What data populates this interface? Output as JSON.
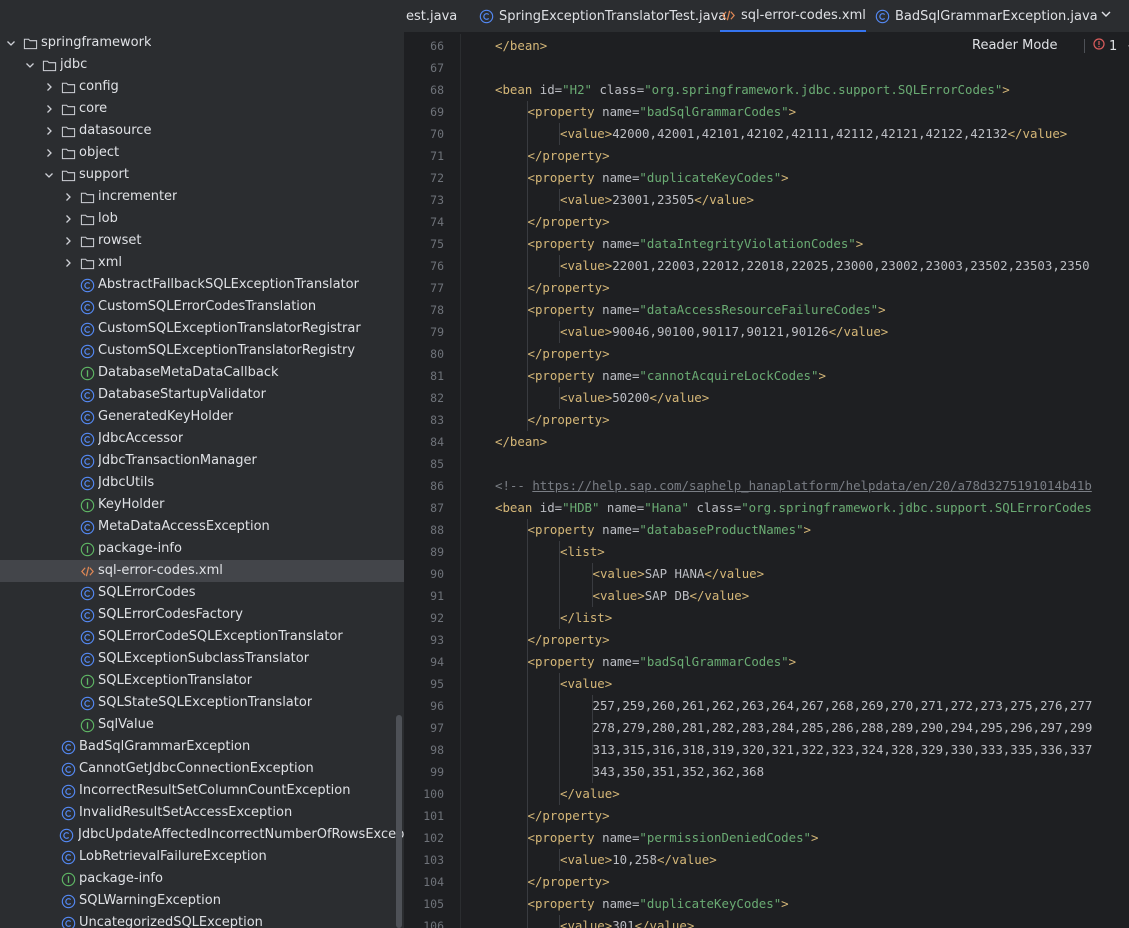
{
  "project_tree": {
    "items": [
      {
        "depth": 0,
        "kind": "folder",
        "expanded": true,
        "label": "springframework",
        "icon": "folder-icon"
      },
      {
        "depth": 1,
        "kind": "folder",
        "expanded": true,
        "label": "jdbc",
        "icon": "folder-icon"
      },
      {
        "depth": 2,
        "kind": "folder",
        "expanded": false,
        "label": "config",
        "icon": "folder-icon"
      },
      {
        "depth": 2,
        "kind": "folder",
        "expanded": false,
        "label": "core",
        "icon": "folder-icon"
      },
      {
        "depth": 2,
        "kind": "folder",
        "expanded": false,
        "label": "datasource",
        "icon": "folder-icon"
      },
      {
        "depth": 2,
        "kind": "folder",
        "expanded": false,
        "label": "object",
        "icon": "folder-icon"
      },
      {
        "depth": 2,
        "kind": "folder",
        "expanded": true,
        "label": "support",
        "icon": "folder-icon"
      },
      {
        "depth": 3,
        "kind": "folder",
        "expanded": false,
        "label": "incrementer",
        "icon": "folder-icon"
      },
      {
        "depth": 3,
        "kind": "folder",
        "expanded": false,
        "label": "lob",
        "icon": "folder-icon"
      },
      {
        "depth": 3,
        "kind": "folder",
        "expanded": false,
        "label": "rowset",
        "icon": "folder-icon"
      },
      {
        "depth": 3,
        "kind": "folder",
        "expanded": false,
        "label": "xml",
        "icon": "folder-icon"
      },
      {
        "depth": 3,
        "kind": "class",
        "label": "AbstractFallbackSQLExceptionTranslator",
        "icon": "class-icon"
      },
      {
        "depth": 3,
        "kind": "class",
        "label": "CustomSQLErrorCodesTranslation",
        "icon": "class-icon"
      },
      {
        "depth": 3,
        "kind": "class",
        "label": "CustomSQLExceptionTranslatorRegistrar",
        "icon": "class-icon"
      },
      {
        "depth": 3,
        "kind": "class",
        "label": "CustomSQLExceptionTranslatorRegistry",
        "icon": "class-icon"
      },
      {
        "depth": 3,
        "kind": "interface",
        "label": "DatabaseMetaDataCallback",
        "icon": "interface-icon"
      },
      {
        "depth": 3,
        "kind": "class",
        "label": "DatabaseStartupValidator",
        "icon": "class-icon"
      },
      {
        "depth": 3,
        "kind": "class",
        "label": "GeneratedKeyHolder",
        "icon": "class-icon"
      },
      {
        "depth": 3,
        "kind": "class",
        "label": "JdbcAccessor",
        "icon": "class-icon"
      },
      {
        "depth": 3,
        "kind": "class",
        "label": "JdbcTransactionManager",
        "icon": "class-icon"
      },
      {
        "depth": 3,
        "kind": "class",
        "label": "JdbcUtils",
        "icon": "class-icon"
      },
      {
        "depth": 3,
        "kind": "interface",
        "label": "KeyHolder",
        "icon": "interface-icon"
      },
      {
        "depth": 3,
        "kind": "class",
        "label": "MetaDataAccessException",
        "icon": "class-icon"
      },
      {
        "depth": 3,
        "kind": "interface",
        "label": "package-info",
        "icon": "interface-icon"
      },
      {
        "depth": 3,
        "kind": "xml",
        "label": "sql-error-codes.xml",
        "icon": "xml-file-icon",
        "selected": true
      },
      {
        "depth": 3,
        "kind": "class",
        "label": "SQLErrorCodes",
        "icon": "class-icon"
      },
      {
        "depth": 3,
        "kind": "class",
        "label": "SQLErrorCodesFactory",
        "icon": "class-icon"
      },
      {
        "depth": 3,
        "kind": "class",
        "label": "SQLErrorCodeSQLExceptionTranslator",
        "icon": "class-icon"
      },
      {
        "depth": 3,
        "kind": "class",
        "label": "SQLExceptionSubclassTranslator",
        "icon": "class-icon"
      },
      {
        "depth": 3,
        "kind": "interface",
        "label": "SQLExceptionTranslator",
        "icon": "interface-icon"
      },
      {
        "depth": 3,
        "kind": "class",
        "label": "SQLStateSQLExceptionTranslator",
        "icon": "class-icon"
      },
      {
        "depth": 3,
        "kind": "interface",
        "label": "SqlValue",
        "icon": "interface-icon"
      },
      {
        "depth": 2,
        "kind": "class",
        "label": "BadSqlGrammarException",
        "icon": "class-icon"
      },
      {
        "depth": 2,
        "kind": "class",
        "label": "CannotGetJdbcConnectionException",
        "icon": "class-icon"
      },
      {
        "depth": 2,
        "kind": "class",
        "label": "IncorrectResultSetColumnCountException",
        "icon": "class-icon"
      },
      {
        "depth": 2,
        "kind": "class",
        "label": "InvalidResultSetAccessException",
        "icon": "class-icon"
      },
      {
        "depth": 2,
        "kind": "class",
        "label": "JdbcUpdateAffectedIncorrectNumberOfRowsException",
        "icon": "class-icon"
      },
      {
        "depth": 2,
        "kind": "class",
        "label": "LobRetrievalFailureException",
        "icon": "class-icon"
      },
      {
        "depth": 2,
        "kind": "interface",
        "label": "package-info",
        "icon": "interface-icon"
      },
      {
        "depth": 2,
        "kind": "class",
        "label": "SQLWarningException",
        "icon": "class-icon"
      },
      {
        "depth": 2,
        "kind": "class",
        "label": "UncategorizedSQLException",
        "icon": "class-icon"
      }
    ]
  },
  "tabs": [
    {
      "label": "est.java",
      "icon": "",
      "active": false
    },
    {
      "label": "SpringExceptionTranslatorTest.java",
      "icon": "class-icon",
      "active": false
    },
    {
      "label": "sql-error-codes.xml",
      "icon": "xml-file-icon",
      "active": true
    },
    {
      "label": "BadSqlGrammarException.java",
      "icon": "class-icon",
      "active": false
    }
  ],
  "editor": {
    "reader_mode_label": "Reader Mode",
    "problems_count": "1",
    "colors": {
      "tag": "#d5b778",
      "string": "#6aab73",
      "comment": "#7a7e85",
      "text": "#bcbec4",
      "accent": "#3574f0"
    },
    "lines": [
      {
        "n": "66",
        "indent": 1,
        "tokens": [
          [
            "tag",
            "</bean>"
          ]
        ]
      },
      {
        "n": "67",
        "indent": 0,
        "tokens": []
      },
      {
        "n": "68",
        "indent": 1,
        "tokens": [
          [
            "tag",
            "<bean "
          ],
          [
            "attr",
            "id="
          ],
          [
            "str",
            "\"H2\""
          ],
          [
            "attr",
            " class="
          ],
          [
            "str",
            "\"org.springframework.jdbc.support.SQLErrorCodes\""
          ],
          [
            "tag",
            ">"
          ]
        ]
      },
      {
        "n": "69",
        "indent": 2,
        "tokens": [
          [
            "tag",
            "<property "
          ],
          [
            "attr",
            "name="
          ],
          [
            "str",
            "\"badSqlGrammarCodes\""
          ],
          [
            "tag",
            ">"
          ]
        ]
      },
      {
        "n": "70",
        "indent": 3,
        "tokens": [
          [
            "tag",
            "<value>"
          ],
          [
            "txt",
            "42000,42001,42101,42102,42111,42112,42121,42122,42132"
          ],
          [
            "tag",
            "</value>"
          ]
        ]
      },
      {
        "n": "71",
        "indent": 2,
        "tokens": [
          [
            "tag",
            "</property>"
          ]
        ]
      },
      {
        "n": "72",
        "indent": 2,
        "tokens": [
          [
            "tag",
            "<property "
          ],
          [
            "attr",
            "name="
          ],
          [
            "str",
            "\"duplicateKeyCodes\""
          ],
          [
            "tag",
            ">"
          ]
        ]
      },
      {
        "n": "73",
        "indent": 3,
        "tokens": [
          [
            "tag",
            "<value>"
          ],
          [
            "txt",
            "23001,23505"
          ],
          [
            "tag",
            "</value>"
          ]
        ]
      },
      {
        "n": "74",
        "indent": 2,
        "tokens": [
          [
            "tag",
            "</property>"
          ]
        ]
      },
      {
        "n": "75",
        "indent": 2,
        "tokens": [
          [
            "tag",
            "<property "
          ],
          [
            "attr",
            "name="
          ],
          [
            "str",
            "\"dataIntegrityViolationCodes\""
          ],
          [
            "tag",
            ">"
          ]
        ]
      },
      {
        "n": "76",
        "indent": 3,
        "tokens": [
          [
            "tag",
            "<value>"
          ],
          [
            "txt",
            "22001,22003,22012,22018,22025,23000,23002,23003,23502,23503,2350"
          ]
        ]
      },
      {
        "n": "77",
        "indent": 2,
        "tokens": [
          [
            "tag",
            "</property>"
          ]
        ]
      },
      {
        "n": "78",
        "indent": 2,
        "tokens": [
          [
            "tag",
            "<property "
          ],
          [
            "attr",
            "name="
          ],
          [
            "str",
            "\"dataAccessResourceFailureCodes\""
          ],
          [
            "tag",
            ">"
          ]
        ]
      },
      {
        "n": "79",
        "indent": 3,
        "tokens": [
          [
            "tag",
            "<value>"
          ],
          [
            "txt",
            "90046,90100,90117,90121,90126"
          ],
          [
            "tag",
            "</value>"
          ]
        ]
      },
      {
        "n": "80",
        "indent": 2,
        "tokens": [
          [
            "tag",
            "</property>"
          ]
        ]
      },
      {
        "n": "81",
        "indent": 2,
        "tokens": [
          [
            "tag",
            "<property "
          ],
          [
            "attr",
            "name="
          ],
          [
            "str",
            "\"cannotAcquireLockCodes\""
          ],
          [
            "tag",
            ">"
          ]
        ]
      },
      {
        "n": "82",
        "indent": 3,
        "tokens": [
          [
            "tag",
            "<value>"
          ],
          [
            "txt",
            "50200"
          ],
          [
            "tag",
            "</value>"
          ]
        ]
      },
      {
        "n": "83",
        "indent": 2,
        "tokens": [
          [
            "tag",
            "</property>"
          ]
        ]
      },
      {
        "n": "84",
        "indent": 1,
        "tokens": [
          [
            "tag",
            "</bean>"
          ]
        ]
      },
      {
        "n": "85",
        "indent": 0,
        "tokens": []
      },
      {
        "n": "86",
        "indent": 1,
        "tokens": [
          [
            "cmt",
            "<!-- "
          ],
          [
            "url",
            "https://help.sap.com/saphelp_hanaplatform/helpdata/en/20/a78d3275191014b41b"
          ]
        ]
      },
      {
        "n": "87",
        "indent": 1,
        "tokens": [
          [
            "tag",
            "<bean "
          ],
          [
            "attr",
            "id="
          ],
          [
            "str",
            "\"HDB\""
          ],
          [
            "attr",
            " name="
          ],
          [
            "str",
            "\"Hana\""
          ],
          [
            "attr",
            " class="
          ],
          [
            "str",
            "\"org.springframework.jdbc.support.SQLErrorCodes"
          ]
        ]
      },
      {
        "n": "88",
        "indent": 2,
        "tokens": [
          [
            "tag",
            "<property "
          ],
          [
            "attr",
            "name="
          ],
          [
            "str",
            "\"databaseProductNames\""
          ],
          [
            "tag",
            ">"
          ]
        ]
      },
      {
        "n": "89",
        "indent": 3,
        "tokens": [
          [
            "tag",
            "<list>"
          ]
        ]
      },
      {
        "n": "90",
        "indent": 4,
        "tokens": [
          [
            "tag",
            "<value>"
          ],
          [
            "txt",
            "SAP HANA"
          ],
          [
            "tag",
            "</value>"
          ]
        ]
      },
      {
        "n": "91",
        "indent": 4,
        "tokens": [
          [
            "tag",
            "<value>"
          ],
          [
            "txt",
            "SAP DB"
          ],
          [
            "tag",
            "</value>"
          ]
        ]
      },
      {
        "n": "92",
        "indent": 3,
        "tokens": [
          [
            "tag",
            "</list>"
          ]
        ]
      },
      {
        "n": "93",
        "indent": 2,
        "tokens": [
          [
            "tag",
            "</property>"
          ]
        ]
      },
      {
        "n": "94",
        "indent": 2,
        "tokens": [
          [
            "tag",
            "<property "
          ],
          [
            "attr",
            "name="
          ],
          [
            "str",
            "\"badSqlGrammarCodes\""
          ],
          [
            "tag",
            ">"
          ]
        ]
      },
      {
        "n": "95",
        "indent": 3,
        "tokens": [
          [
            "tag",
            "<value>"
          ]
        ]
      },
      {
        "n": "96",
        "indent": 4,
        "tokens": [
          [
            "txt",
            "257,259,260,261,262,263,264,267,268,269,270,271,272,273,275,276,277"
          ]
        ]
      },
      {
        "n": "97",
        "indent": 4,
        "tokens": [
          [
            "txt",
            "278,279,280,281,282,283,284,285,286,288,289,290,294,295,296,297,299"
          ]
        ]
      },
      {
        "n": "98",
        "indent": 4,
        "tokens": [
          [
            "txt",
            "313,315,316,318,319,320,321,322,323,324,328,329,330,333,335,336,337"
          ]
        ]
      },
      {
        "n": "99",
        "indent": 4,
        "tokens": [
          [
            "txt",
            "343,350,351,352,362,368"
          ]
        ]
      },
      {
        "n": "100",
        "indent": 3,
        "tokens": [
          [
            "tag",
            "</value>"
          ]
        ]
      },
      {
        "n": "101",
        "indent": 2,
        "tokens": [
          [
            "tag",
            "</property>"
          ]
        ]
      },
      {
        "n": "102",
        "indent": 2,
        "tokens": [
          [
            "tag",
            "<property "
          ],
          [
            "attr",
            "name="
          ],
          [
            "str",
            "\"permissionDeniedCodes\""
          ],
          [
            "tag",
            ">"
          ]
        ]
      },
      {
        "n": "103",
        "indent": 3,
        "tokens": [
          [
            "tag",
            "<value>"
          ],
          [
            "txt",
            "10,258"
          ],
          [
            "tag",
            "</value>"
          ]
        ]
      },
      {
        "n": "104",
        "indent": 2,
        "tokens": [
          [
            "tag",
            "</property>"
          ]
        ]
      },
      {
        "n": "105",
        "indent": 2,
        "tokens": [
          [
            "tag",
            "<property "
          ],
          [
            "attr",
            "name="
          ],
          [
            "str",
            "\"duplicateKeyCodes\""
          ],
          [
            "tag",
            ">"
          ]
        ]
      },
      {
        "n": "106",
        "indent": 3,
        "tokens": [
          [
            "tag",
            "<value>"
          ],
          [
            "txt",
            "301"
          ],
          [
            "tag",
            "</value>"
          ]
        ]
      }
    ]
  }
}
